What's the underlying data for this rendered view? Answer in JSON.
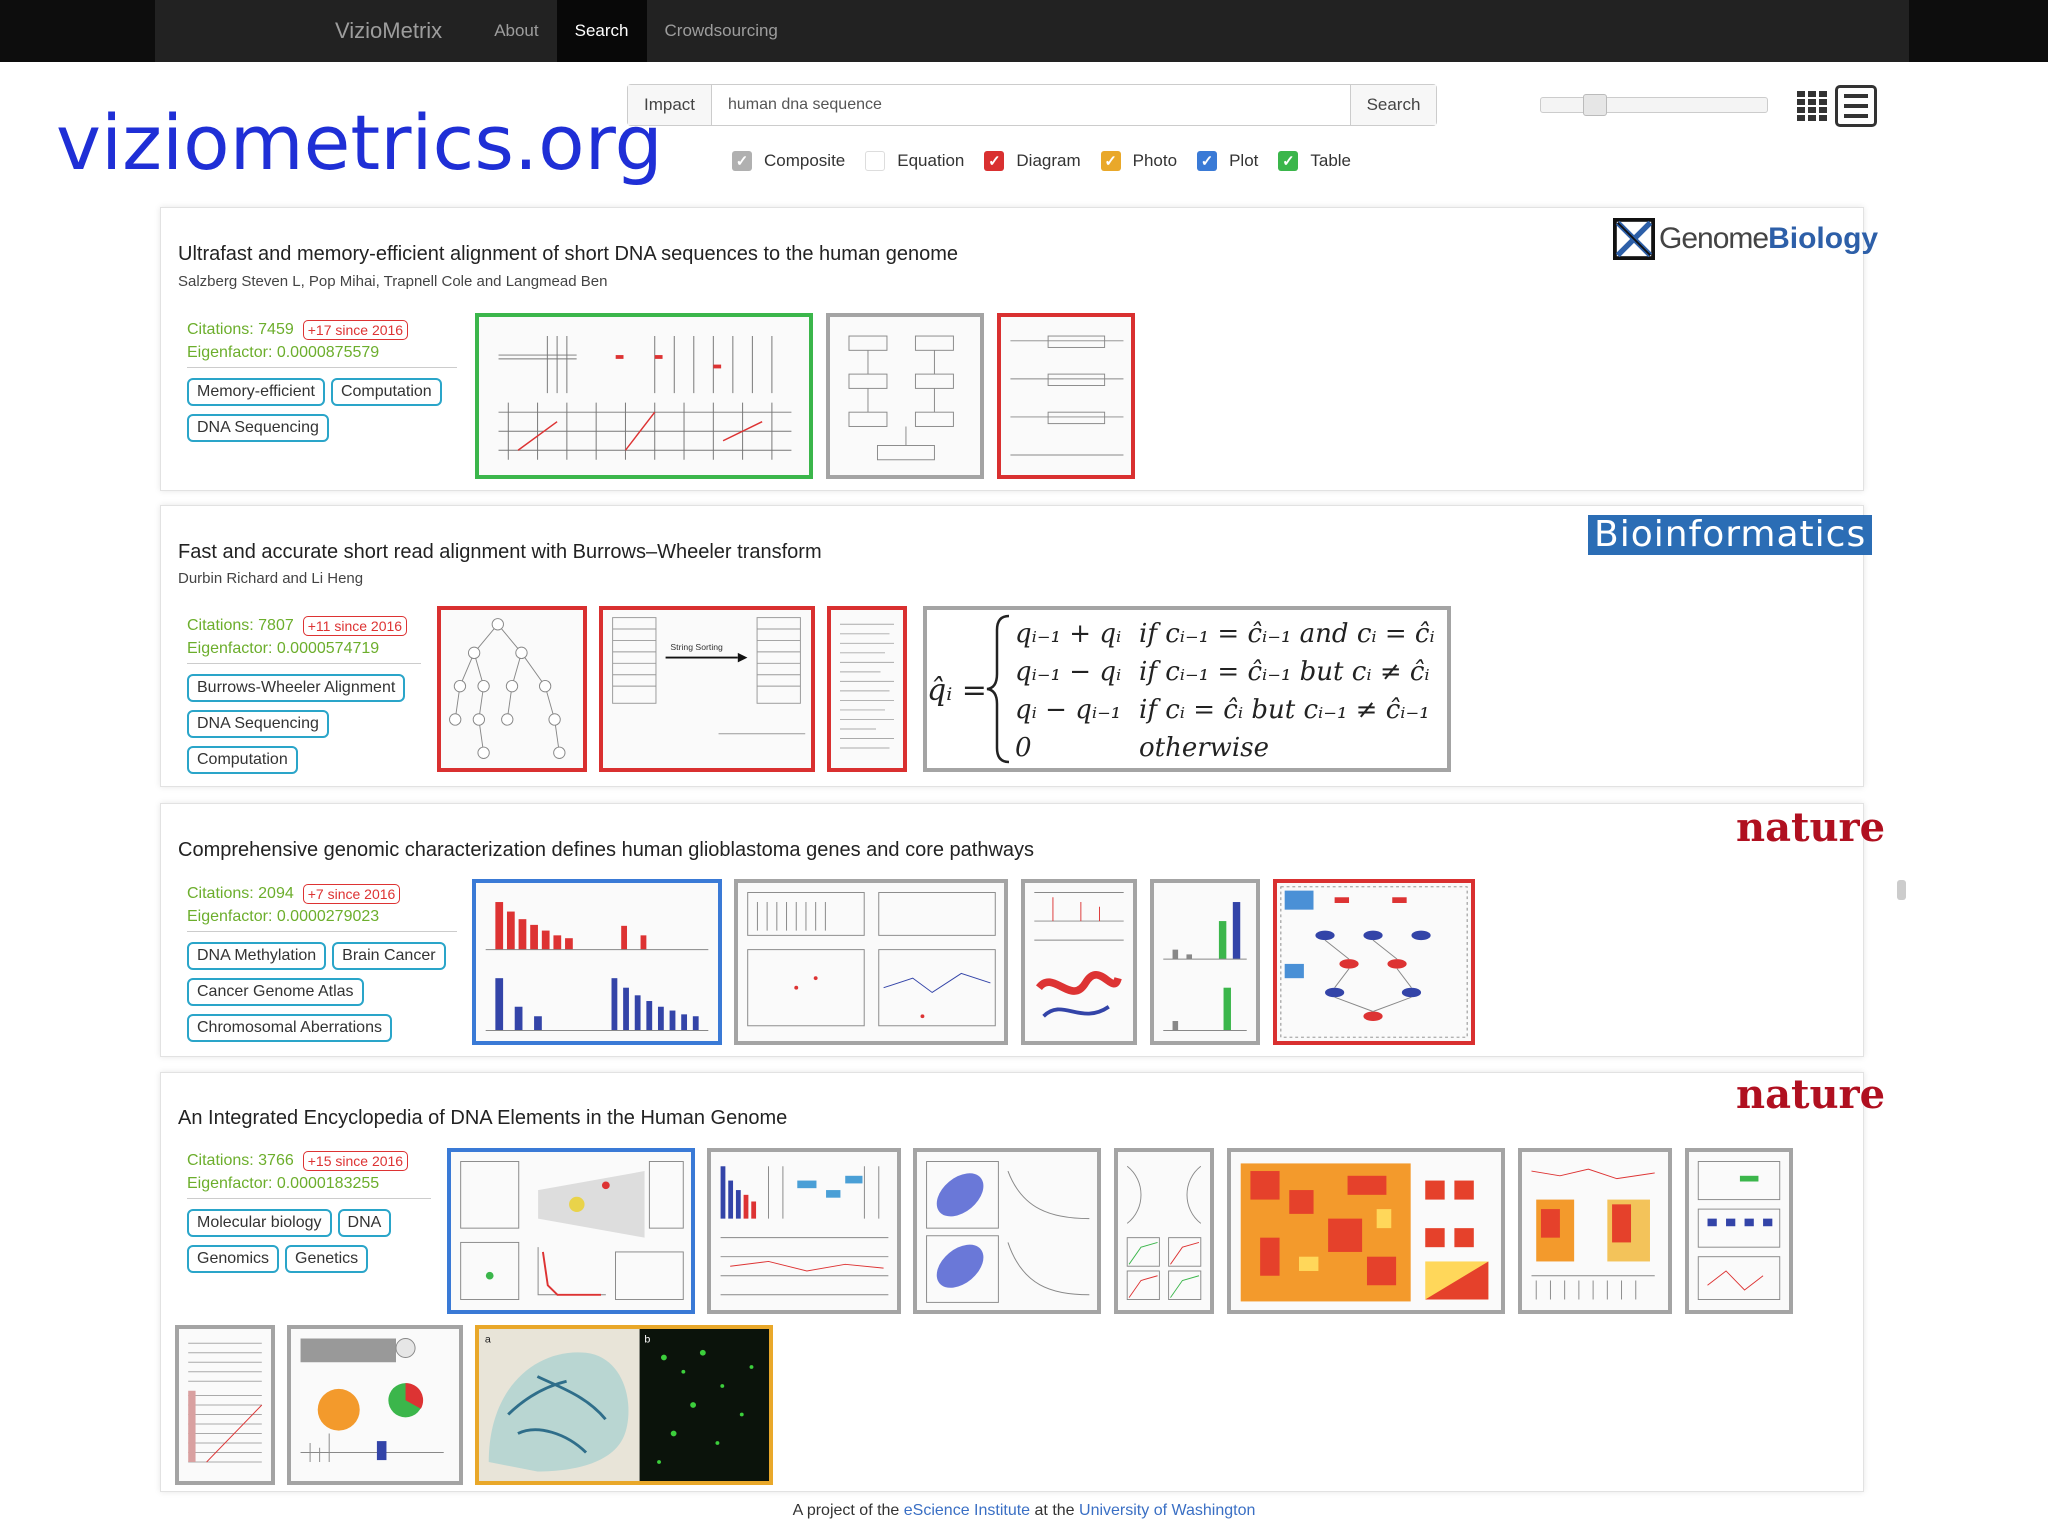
{
  "site_url": "viziometrics.org",
  "nav": {
    "brand": "VizioMetrix",
    "items": [
      "About",
      "Search",
      "Crowdsourcing"
    ],
    "active": "Search"
  },
  "search": {
    "impact_label": "Impact",
    "query": "human dna sequence",
    "search_label": "Search"
  },
  "slider": {
    "value": 0.2
  },
  "filters": [
    {
      "label": "Composite",
      "checked": true,
      "color": "#b0b0b0"
    },
    {
      "label": "Equation",
      "checked": false,
      "color": "#ffffff"
    },
    {
      "label": "Diagram",
      "checked": true,
      "color": "#d93030"
    },
    {
      "label": "Photo",
      "checked": true,
      "color": "#e9a82a"
    },
    {
      "label": "Plot",
      "checked": true,
      "color": "#3a7ad6"
    },
    {
      "label": "Table",
      "checked": true,
      "color": "#3bb64b"
    }
  ],
  "papers": [
    {
      "title": "Ultrafast and memory-efficient alignment of short DNA sequences to the human genome",
      "authors": "Salzberg Steven L, Pop Mihai, Trapnell Cole and Langmead Ben",
      "citations": "Citations: 7459",
      "since": "+17 since 2016",
      "eigenfactor": "Eigenfactor: 0.0000875579",
      "tags": [
        "Memory-efficient",
        "Computation",
        "DNA Sequencing"
      ],
      "journal": {
        "part1": "Genome",
        "part2": "Biology"
      }
    },
    {
      "title": "Fast and accurate short read alignment with Burrows–Wheeler transform",
      "authors": "Durbin Richard and Li Heng",
      "citations": "Citations: 7807",
      "since": "+11 since 2016",
      "eigenfactor": "Eigenfactor: 0.0000574719",
      "tags": [
        "Burrows-Wheeler Alignment",
        "DNA Sequencing",
        "Computation"
      ],
      "journal": "Bioinformatics",
      "thumb_text": {
        "arrow_label": "String Sorting"
      },
      "equation": {
        "lhs": "q̂ᵢ =",
        "rows": [
          [
            "qᵢ₋₁ + qᵢ",
            "if cᵢ₋₁ = ĉᵢ₋₁  and cᵢ = ĉᵢ"
          ],
          [
            "qᵢ₋₁ − qᵢ",
            "if cᵢ₋₁ = ĉᵢ₋₁  but cᵢ ≠ ĉᵢ"
          ],
          [
            "qᵢ − qᵢ₋₁",
            "if cᵢ = ĉᵢ  but cᵢ₋₁ ≠ ĉᵢ₋₁"
          ],
          [
            "0",
            "otherwise"
          ]
        ]
      }
    },
    {
      "title": "Comprehensive genomic characterization defines human glioblastoma genes and core pathways",
      "citations": "Citations: 2094",
      "since": "+7 since 2016",
      "eigenfactor": "Eigenfactor: 0.0000279023",
      "tags": [
        "DNA Methylation",
        "Brain Cancer",
        "Cancer Genome Atlas",
        "Chromosomal Aberrations"
      ],
      "journal": "nature"
    },
    {
      "title": "An Integrated Encyclopedia of DNA Elements in the Human Genome",
      "citations": "Citations: 3766",
      "since": "+15 since 2016",
      "eigenfactor": "Eigenfactor: 0.0000183255",
      "tags": [
        "Molecular biology",
        "DNA",
        "Genomics",
        "Genetics"
      ],
      "journal": "nature",
      "thumb_text": {
        "panel_a": "a",
        "panel_b": "b"
      }
    }
  ],
  "footer": {
    "prefix": "A project of the",
    "link1": "eScience Institute",
    "middle": "at the",
    "link2": "University of Washington"
  },
  "colors": {
    "citation_green": "#6cae2c",
    "tag_border": "#2aa5c9",
    "url_blue": "#1f2fd6",
    "nature_red": "#b01020",
    "bioinformatics_blue": "#2b6db5"
  }
}
